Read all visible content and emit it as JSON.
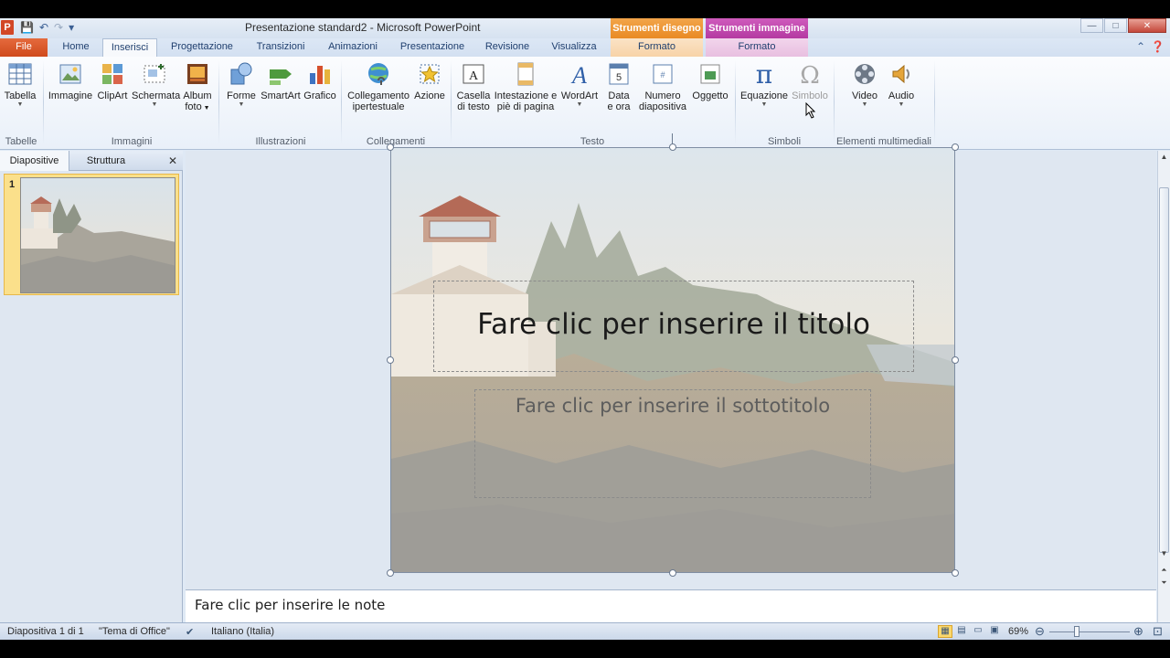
{
  "window": {
    "title": "Presentazione standard2 - Microsoft PowerPoint",
    "app_icon": "P",
    "contextual_tabs": [
      "Strumenti disegno",
      "Strumenti immagine"
    ],
    "buttons": {
      "minimize": "—",
      "maximize": "□",
      "close": "✕"
    }
  },
  "quick_access": {
    "save_icon": "💾",
    "undo_icon": "↶",
    "redo_icon": "↷",
    "customize_icon": "▾"
  },
  "tabs": {
    "file": "File",
    "home": "Home",
    "insert": "Inserisci",
    "design": "Progettazione",
    "transitions": "Transizioni",
    "animations": "Animazioni",
    "slideshow": "Presentazione",
    "review": "Revisione",
    "view": "Visualizza",
    "format_draw": "Formato",
    "format_image": "Formato"
  },
  "ribbon": {
    "items": {
      "table": "Tabella",
      "picture": "Immagine",
      "clipart": "ClipArt",
      "screenshot": "Schermata",
      "album_l1": "Album",
      "album_l2": "foto",
      "shapes": "Forme",
      "smartart": "SmartArt",
      "chart": "Grafico",
      "hyperlink_l1": "Collegamento",
      "hyperlink_l2": "ipertestuale",
      "action": "Azione",
      "textbox_l1": "Casella",
      "textbox_l2": "di testo",
      "header_l1": "Intestazione e",
      "header_l2": "piè di pagina",
      "wordart": "WordArt",
      "datetime_l1": "Data",
      "datetime_l2": "e ora",
      "slidenum_l1": "Numero",
      "slidenum_l2": "diapositiva",
      "object": "Oggetto",
      "equation": "Equazione",
      "symbol": "Simbolo",
      "video": "Video",
      "audio": "Audio"
    },
    "groups": {
      "tables": "Tabelle",
      "images": "Immagini",
      "illustrations": "Illustrazioni",
      "links": "Collegamenti",
      "text": "Testo",
      "symbols": "Simboli",
      "media": "Elementi multimediali"
    }
  },
  "left_panel": {
    "tab_slides": "Diapositive",
    "tab_outline": "Struttura",
    "close_icon": "✕",
    "slide_number": "1"
  },
  "slide": {
    "title_placeholder": "Fare clic per inserire il titolo",
    "subtitle_placeholder": "Fare clic per inserire il sottotitolo"
  },
  "notes": {
    "placeholder": "Fare clic per inserire le note"
  },
  "status": {
    "slide_info": "Diapositiva 1 di 1",
    "theme": "\"Tema di Office\"",
    "language": "Italiano (Italia)",
    "zoom": "69%"
  },
  "colors": {
    "file_tab": "#d24726",
    "ctx_draw": "#e98a24",
    "ctx_image": "#b43aa1",
    "selection_highlight": "#fbe08b"
  }
}
